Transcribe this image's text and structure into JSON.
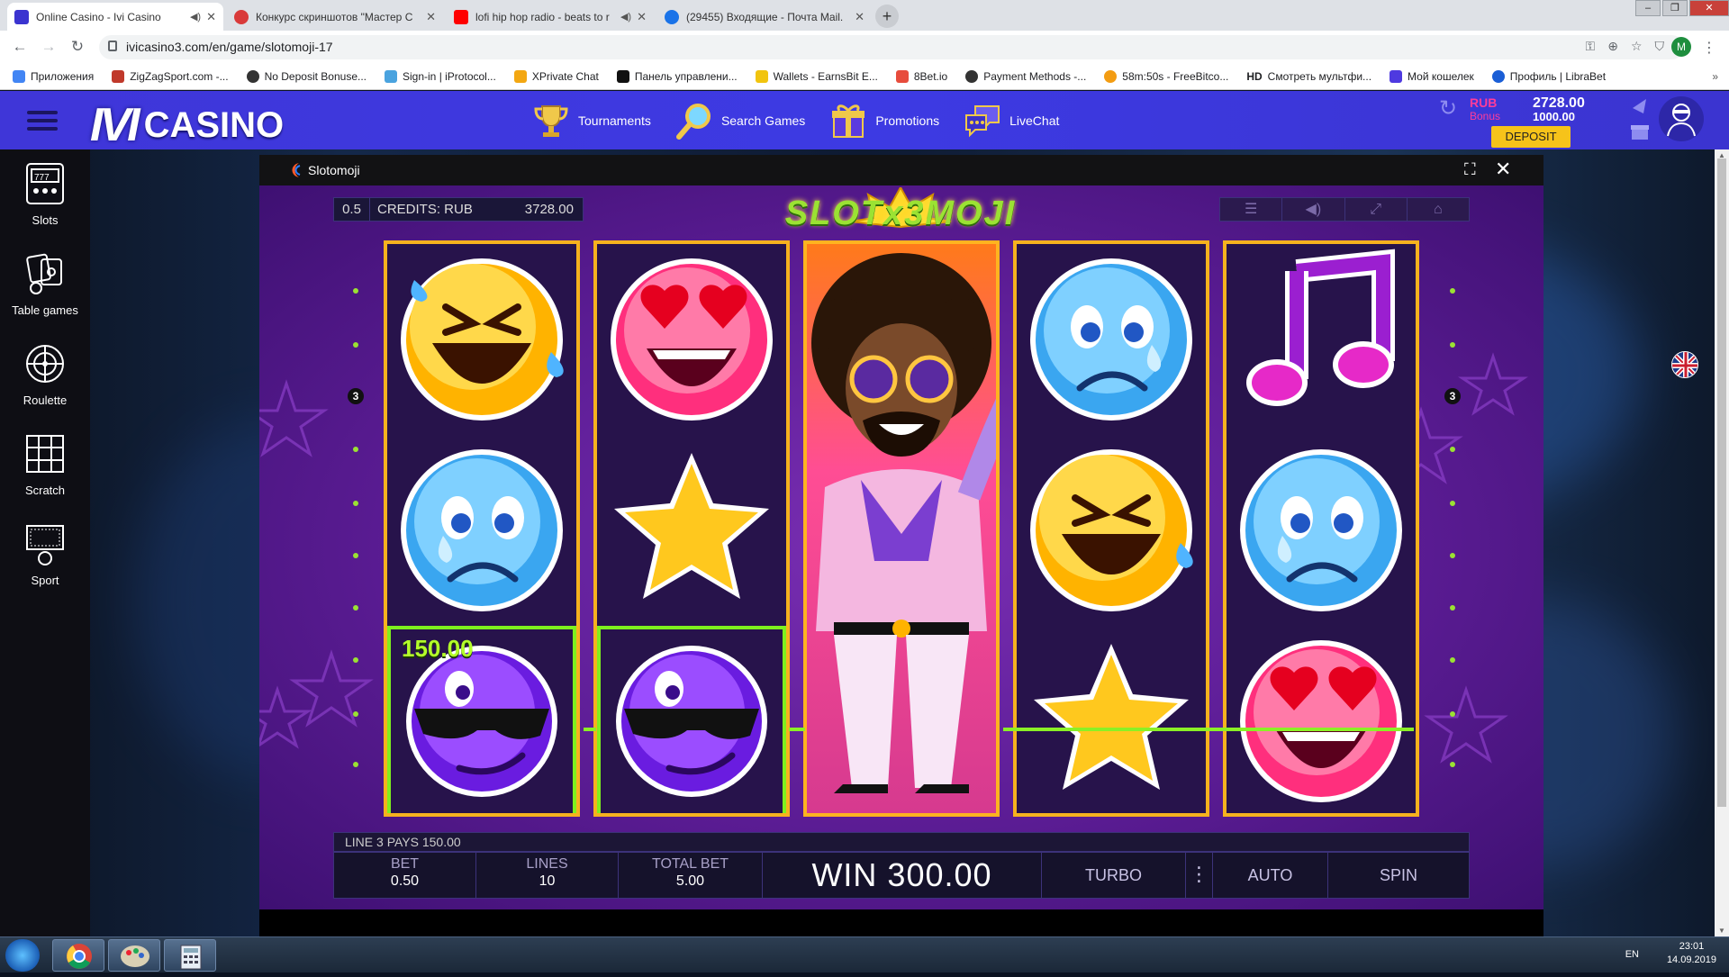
{
  "browser": {
    "tabs": [
      {
        "title": "Online Casino - Ivi Casino",
        "color": "#3b34d0",
        "active": true,
        "audio": true
      },
      {
        "title": "Конкурс скриншотов \"Мастер С",
        "color": "#d93a3a",
        "active": false,
        "audio": false
      },
      {
        "title": "lofi hip hop radio - beats to r",
        "color": "#ff0000",
        "active": false,
        "audio": true
      },
      {
        "title": "(29455) Входящие - Почта Mail.",
        "color": "#1a73e8",
        "active": false,
        "audio": false
      }
    ],
    "url": "ivicasino3.com/en/game/slotomoji-17",
    "profile_initial": "M",
    "bookmarks": [
      {
        "label": "Приложения",
        "color": "#4285f4"
      },
      {
        "label": "ZigZagSport.com -...",
        "color": "#c0392b"
      },
      {
        "label": "No Deposit Bonuse...",
        "color": "#333333"
      },
      {
        "label": "Sign-in | iProtocol...",
        "color": "#4aa3df"
      },
      {
        "label": "XPrivate Chat",
        "color": "#f3a712"
      },
      {
        "label": "Панель управлени...",
        "color": "#111111"
      },
      {
        "label": "Wallets - EarnsBit E...",
        "color": "#f1c40f"
      },
      {
        "label": "8Bet.io",
        "color": "#e74c3c"
      },
      {
        "label": "Payment Methods -...",
        "color": "#333333"
      },
      {
        "label": "58m:50s - FreeBitco...",
        "color": "#f39c12"
      },
      {
        "label": "Смотреть мультфи...",
        "color": "#000000",
        "prefix": "HD"
      },
      {
        "label": "Мой кошелек",
        "color": "#4e3ae0"
      },
      {
        "label": "Профиль | LibraBet",
        "color": "#1a5ed6"
      }
    ]
  },
  "site": {
    "logo_ivi": "IVI",
    "logo_casino": "CASINO",
    "nav": [
      {
        "label": "Tournaments",
        "icon": "trophy-icon"
      },
      {
        "label": "Search Games",
        "icon": "search-icon"
      },
      {
        "label": "Promotions",
        "icon": "gift-icon"
      },
      {
        "label": "LiveChat",
        "icon": "chat-icon"
      }
    ],
    "currency": "RUB",
    "bonus_label": "Bonus",
    "balance": "2728.00",
    "bonus_balance": "1000.00",
    "deposit_label": "DEPOSIT"
  },
  "sidebar": [
    {
      "label": "Slots",
      "icon": "slot-machine-icon"
    },
    {
      "label": "Table games",
      "icon": "table-games-icon"
    },
    {
      "label": "Roulette",
      "icon": "roulette-icon"
    },
    {
      "label": "Scratch",
      "icon": "scratch-icon"
    },
    {
      "label": "Sport",
      "icon": "sport-icon"
    }
  ],
  "game": {
    "title": "Slotomoji",
    "logo": "SLOTx3MOJI",
    "bet_value": "0.5",
    "credits_label": "CREDITS: RUB",
    "credits_amount": "3728.00",
    "win_label": "150.00",
    "line_pays": "LINE 3 PAYS 150.00",
    "line_number_left": "3",
    "line_number_right": "3",
    "controls": {
      "bet_label": "BET",
      "bet_value": "0.50",
      "lines_label": "LINES",
      "lines_value": "10",
      "total_label": "TOTAL BET",
      "total_value": "5.00",
      "win": "WIN 300.00",
      "turbo": "TURBO",
      "dots": "⋮",
      "auto": "AUTO",
      "spin": "SPIN"
    },
    "reels": [
      [
        "laughing-tears",
        "crying",
        "cool-sunglasses"
      ],
      [
        "heart-eyes",
        "star",
        "cool-sunglasses"
      ],
      [
        "wild-disco"
      ],
      [
        "crying",
        "laughing-tears",
        "star"
      ],
      [
        "music-note",
        "crying",
        "heart-eyes"
      ]
    ]
  },
  "taskbar": {
    "lang": "EN",
    "time": "23:01",
    "date": "14.09.2019"
  }
}
